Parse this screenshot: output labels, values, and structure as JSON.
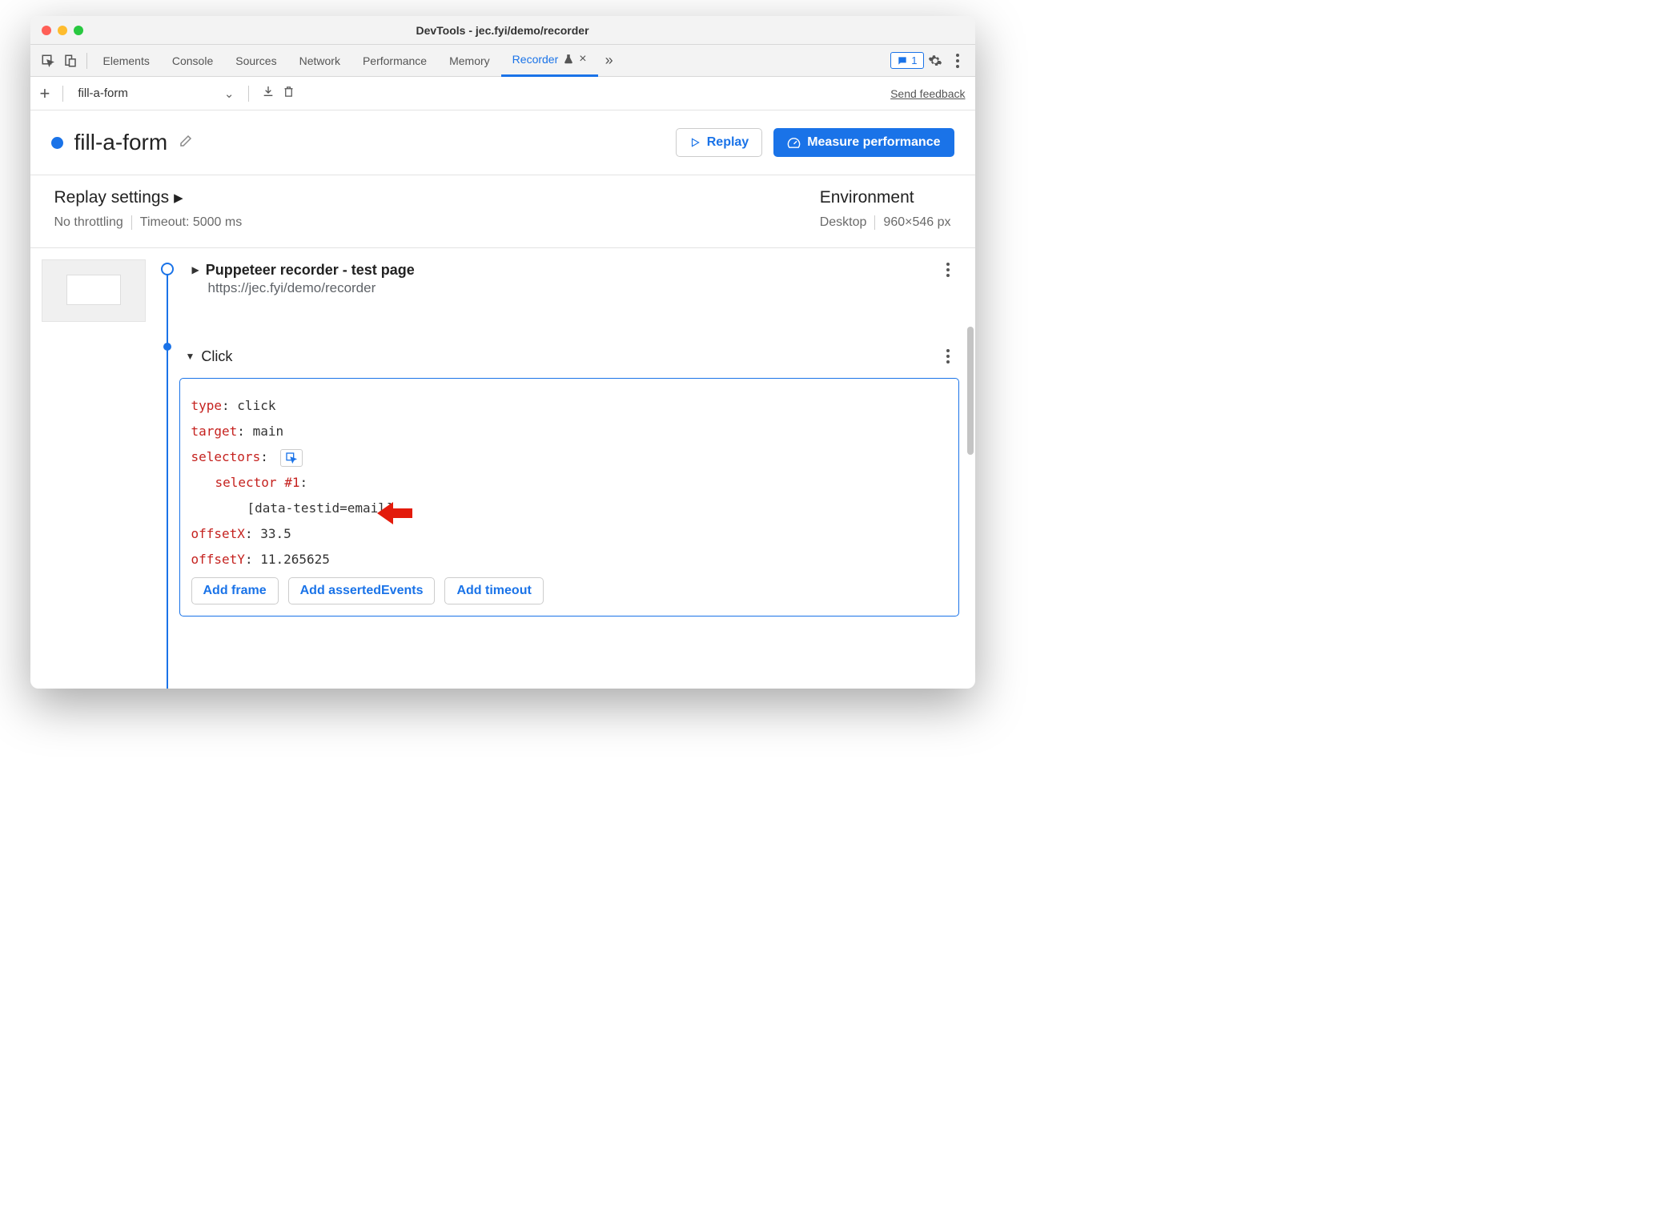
{
  "window": {
    "title": "DevTools - jec.fyi/demo/recorder"
  },
  "tabs": {
    "items": [
      "Elements",
      "Console",
      "Sources",
      "Network",
      "Performance",
      "Memory"
    ],
    "active": "Recorder",
    "issues_count": "1"
  },
  "recorder_bar": {
    "selected": "fill-a-form",
    "feedback": "Send feedback"
  },
  "header": {
    "name": "fill-a-form",
    "replay": "Replay",
    "measure": "Measure performance"
  },
  "settings": {
    "replay_title": "Replay settings",
    "throttling": "No throttling",
    "timeout": "Timeout: 5000 ms",
    "env_title": "Environment",
    "device": "Desktop",
    "dimensions": "960×546 px"
  },
  "steps": {
    "s1": {
      "title": "Puppeteer recorder - test page",
      "url": "https://jec.fyi/demo/recorder"
    },
    "s2": {
      "title": "Click",
      "props": {
        "type_k": "type",
        "type_v": "click",
        "target_k": "target",
        "target_v": "main",
        "selectors_k": "selectors",
        "sel_label": "selector #1",
        "sel_value": "[data-testid=email]",
        "offx_k": "offsetX",
        "offx_v": "33.5",
        "offy_k": "offsetY",
        "offy_v": "11.265625"
      },
      "add": {
        "frame": "Add frame",
        "asserted": "Add assertedEvents",
        "timeout": "Add timeout"
      }
    }
  }
}
